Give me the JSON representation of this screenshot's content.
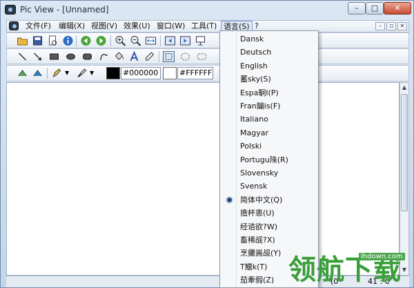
{
  "window": {
    "title": "Pic View - [Unnamed]"
  },
  "menubar": {
    "items": [
      "文件(F)",
      "编辑(X)",
      "视图(V)",
      "效果(U)",
      "窗口(W)",
      "工具(T)",
      "语言(S)",
      "?"
    ]
  },
  "colors": {
    "foreground": {
      "value": "#000000"
    },
    "background": {
      "value": "#FFFFFF"
    }
  },
  "language_menu": {
    "items": [
      "Dansk",
      "Deutsch",
      "English",
      "蓄sky(S)",
      "Espa駉l(P)",
      "Fran鏰is(F)",
      "Italiano",
      "Magyar",
      "Polski",
      "Portugu陎(R)",
      "Slovensky",
      "Svensk",
      "简体中文(Q)",
      "擔杯悤(U)",
      "经谘欲?W)",
      "畜稀觇?X)",
      "烹攤嵩觇(Y)",
      "T鱲k(T)",
      "茄牽徦(Z)"
    ],
    "selected": "简体中文(Q)"
  },
  "statusbar": {
    "left": "(0",
    "right": "41 : 0"
  },
  "watermark": {
    "text": "领航下载",
    "url": "lhdown.com"
  }
}
